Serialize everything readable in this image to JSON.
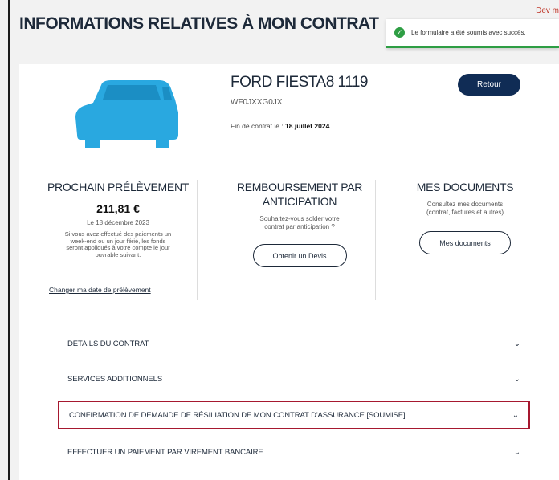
{
  "page": {
    "title": "INFORMATIONS RELATIVES À MON CONTRAT",
    "corner_text": "Dev m"
  },
  "toast": {
    "icon": "check-circle-icon",
    "message": "Le formulaire a été soumis avec succès."
  },
  "vehicle": {
    "name": "FORD FIESTA8 1119",
    "vin": "WF0JXXG0JX",
    "end_label": "Fin de contrat le : ",
    "end_date": "18 juillet 2024",
    "back_label": "Retour",
    "image_color": "#29a8e0"
  },
  "columns": {
    "payment": {
      "title": "PROCHAIN PRÉLÈVEMENT",
      "amount": "211,81 €",
      "date": "Le 18 décembre 2023",
      "note": "Si vous avez effectué des paiements un week-end ou un jour férié, les fonds seront appliqués à votre compte le jour ouvrable suivant.",
      "link": "Changer ma date de prélèvement"
    },
    "early": {
      "title_line1": "REMBOURSEMENT PAR",
      "title_line2": "ANTICIPATION",
      "desc_line1": "Souhaitez-vous solder votre",
      "desc_line2": "contrat par anticipation ?",
      "button": "Obtenir un Devis"
    },
    "docs": {
      "title": "MES DOCUMENTS",
      "desc_line1": "Consultez mes documents",
      "desc_line2": "(contrat, factures et autres)",
      "button": "Mes documents"
    }
  },
  "accordion": [
    {
      "label": "DÉTAILS DU CONTRAT"
    },
    {
      "label": "SERVICES ADDITIONNELS"
    },
    {
      "label": "CONFIRMATION DE DEMANDE DE RÉSILIATION DE MON CONTRAT D'ASSURANCE [SOUMISE]"
    },
    {
      "label": "EFFECTUER UN PAIEMENT PAR VIREMENT BANCAIRE"
    }
  ],
  "colors": {
    "brand_navy": "#102c55",
    "success_green": "#2e9e44",
    "highlight_red": "#a6182f"
  }
}
